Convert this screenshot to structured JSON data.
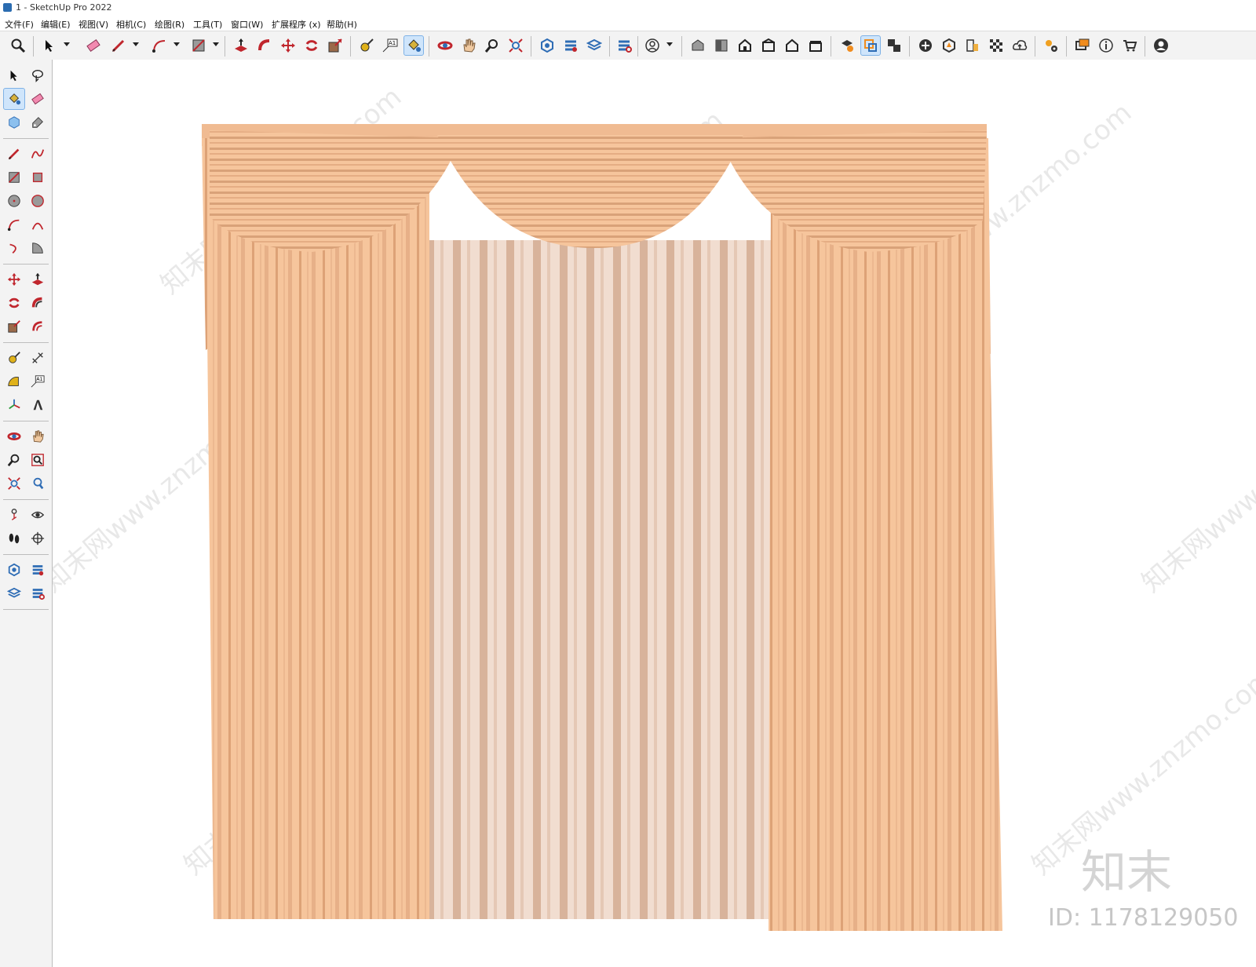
{
  "window": {
    "title": "1 - SketchUp Pro 2022"
  },
  "menubar": {
    "items": [
      "文件(F)",
      "编辑(E)",
      "视图(V)",
      "相机(C)",
      "绘图(R)",
      "工具(T)",
      "窗口(W)",
      "扩展程序 (x)",
      "帮助(H)"
    ]
  },
  "toolbar": {
    "icons": [
      "zoom-icon",
      "select-icon",
      "eraser-icon",
      "pencil-icon",
      "arc-icon",
      "rectangle-icon",
      "push-pull-icon",
      "follow-me-icon",
      "move-icon",
      "rotate-icon",
      "scale-icon",
      "tape-measure-icon",
      "text-icon",
      "paint-bucket-icon",
      "orbit-icon",
      "pan-icon",
      "zoom-window-icon",
      "zoom-extents-icon",
      "warehouse-icon",
      "extension-warehouse-icon",
      "layout-icon",
      "extension-manager-icon",
      "profile-icon",
      "iso-view-icon",
      "top-view-icon",
      "front-view-icon",
      "right-view-icon",
      "back-view-icon",
      "left-view-icon",
      "section-plane-icon",
      "display-section-icon",
      "section-cut-icon",
      "add-location-icon",
      "terrain-icon",
      "photo-texture-icon",
      "match-photo-icon",
      "trimble-connect-icon",
      "settings-icon",
      "chat-icon",
      "info-icon",
      "cart-icon",
      "account-icon"
    ],
    "active_tool": "paint-bucket-icon"
  },
  "watermark": {
    "repeat_text": "知末网www.znzmo.com",
    "brand": "知末",
    "id_text": "ID: 1178129050"
  },
  "colors": {
    "curtain": "#f6c59c",
    "curtain_shade": "#d9a279",
    "sheer": "#f1ddd0",
    "sheer_shade": "#cfa98f",
    "ui_bg": "#f3f3f3",
    "active_bg": "#cfe5fb",
    "accent_red": "#d02b2b",
    "accent_blue": "#2f6db5"
  }
}
